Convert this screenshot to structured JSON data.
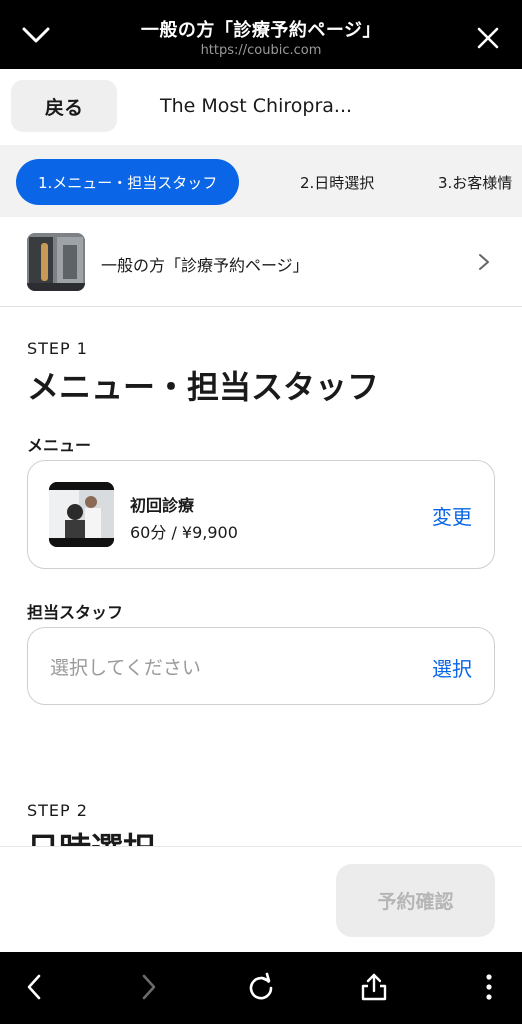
{
  "browser": {
    "title": "一般の方「診療予約ページ」",
    "url": "https://coubic.com"
  },
  "header": {
    "back_label": "戻る",
    "shop_name": "The Most Chiropra..."
  },
  "tabs": [
    {
      "label": "1.メニュー・担当スタッフ",
      "active": true
    },
    {
      "label": "2.日時選択",
      "active": false
    },
    {
      "label": "3.お客様情",
      "active": false
    }
  ],
  "page_link": {
    "label": "一般の方「診療予約ページ」"
  },
  "step1": {
    "step_label": "STEP 1",
    "title": "メニュー・担当スタッフ",
    "menu_label": "メニュー",
    "menu": {
      "name": "初回診療",
      "price": "60分 / ¥9,900",
      "change_label": "変更"
    },
    "staff_label": "担当スタッフ",
    "staff": {
      "placeholder": "選択してください",
      "select_label": "選択"
    }
  },
  "step2": {
    "step_label": "STEP 2",
    "title": "日時選択"
  },
  "actions": {
    "reserve_label": "予約確認"
  },
  "colors": {
    "accent": "#0a66e6",
    "disabled_bg": "#ececec",
    "disabled_text": "#b6b6b6"
  },
  "icons": {
    "top_left": "chevron-down-icon",
    "top_right": "close-icon",
    "nav": [
      "back-arrow-icon",
      "forward-arrow-icon",
      "reload-icon",
      "share-icon",
      "more-vertical-icon"
    ]
  }
}
